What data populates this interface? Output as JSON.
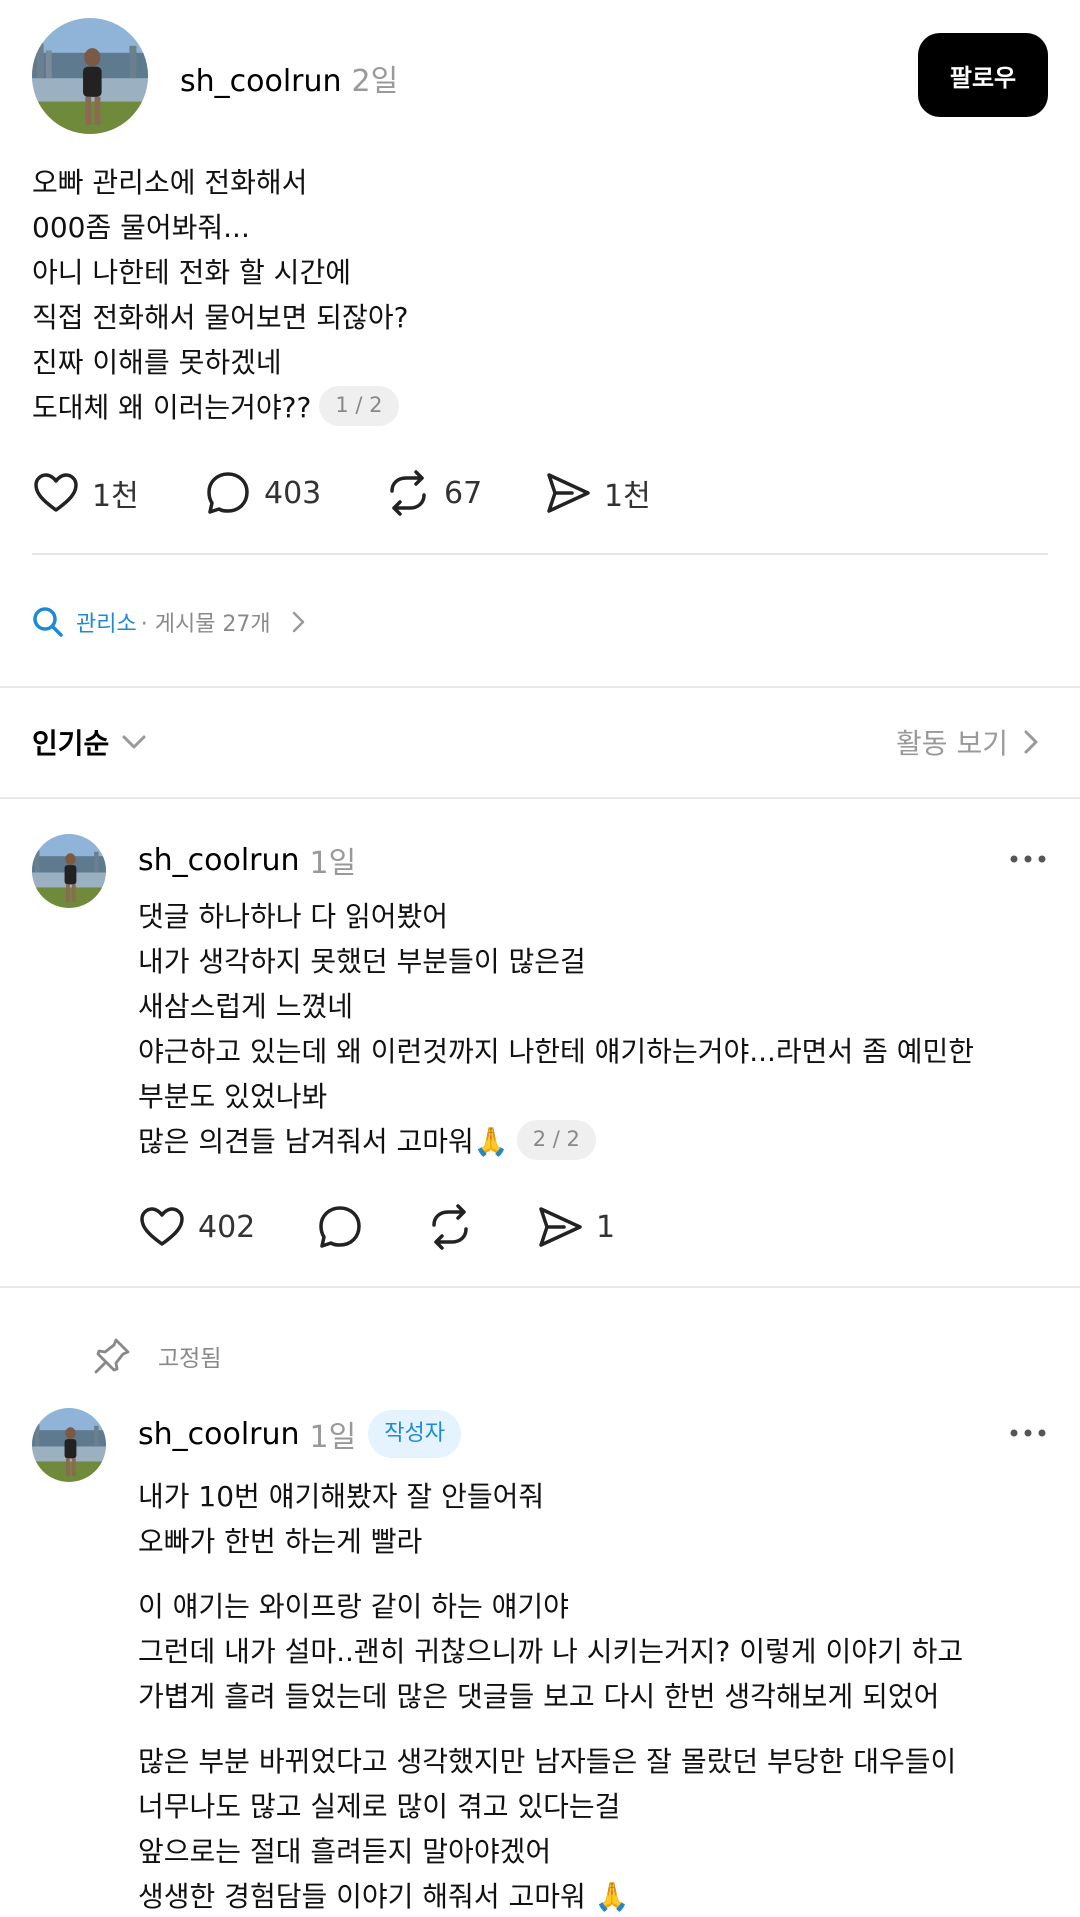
{
  "post": {
    "username": "sh_coolrun",
    "time": "2일",
    "follow_label": "팔로우",
    "lines": [
      "오빠 관리소에 전화해서",
      "000좀 물어봐줘...",
      "아니 나한테 전화 할 시간에",
      "직접 전화해서 물어보면 되잖아?",
      "진짜 이해를 못하겠네",
      "도대체 왜 이러는거야??"
    ],
    "page_indicator": "1 / 2",
    "likes": "1천",
    "replies": "403",
    "reposts": "67",
    "shares": "1천"
  },
  "topic": {
    "name": "관리소",
    "meta": "· 게시물 27개"
  },
  "sort": {
    "label": "인기순",
    "activity_label": "활동 보기"
  },
  "comments": [
    {
      "username": "sh_coolrun",
      "time": "1일",
      "lines": [
        "댓글 하나하나 다 읽어봤어",
        "내가 생각하지 못했던 부분들이 많은걸",
        "새삼스럽게 느꼈네",
        "야근하고 있는데 왜 이런것까지 나한테 얘기하는거야...라면서 좀 예민한",
        "부분도 있었나봐",
        "많은 의견들 남겨줘서 고마워🙏"
      ],
      "page_indicator": "2 / 2",
      "likes": "402",
      "shares": "1"
    },
    {
      "pinned_label": "고정됨",
      "username": "sh_coolrun",
      "time": "1일",
      "author_badge": "작성자",
      "paragraphs": [
        [
          "내가 10번 얘기해봤자 잘 안들어줘",
          "오빠가 한번 하는게 빨라"
        ],
        [
          "이 얘기는 와이프랑 같이 하는 얘기야",
          "그런데 내가 설마..괜히 귀찮으니까 나 시키는거지? 이렇게 이야기 하고",
          "가볍게 흘려 들었는데 많은 댓글들 보고 다시 한번 생각해보게 되었어"
        ],
        [
          "많은 부분 바뀌었다고 생각했지만 남자들은 잘 몰랐던 부당한 대우들이",
          "너무나도 많고 실제로 많이 겪고 있다는걸",
          "앞으로는 절대 흘려듣지 말아야겠어",
          "생생한 경험담들 이야기 해줘서 고마워 🙏"
        ]
      ]
    }
  ],
  "colors": {
    "accent_blue": "#1e8ad6",
    "badge_bg": "#e4f3fd",
    "muted": "#999999"
  },
  "icons": [
    "heart-icon",
    "reply-bubble-icon",
    "repost-icon",
    "share-send-icon",
    "search-icon",
    "chevron-right-icon",
    "chevron-down-icon",
    "more-icon",
    "pin-icon"
  ]
}
